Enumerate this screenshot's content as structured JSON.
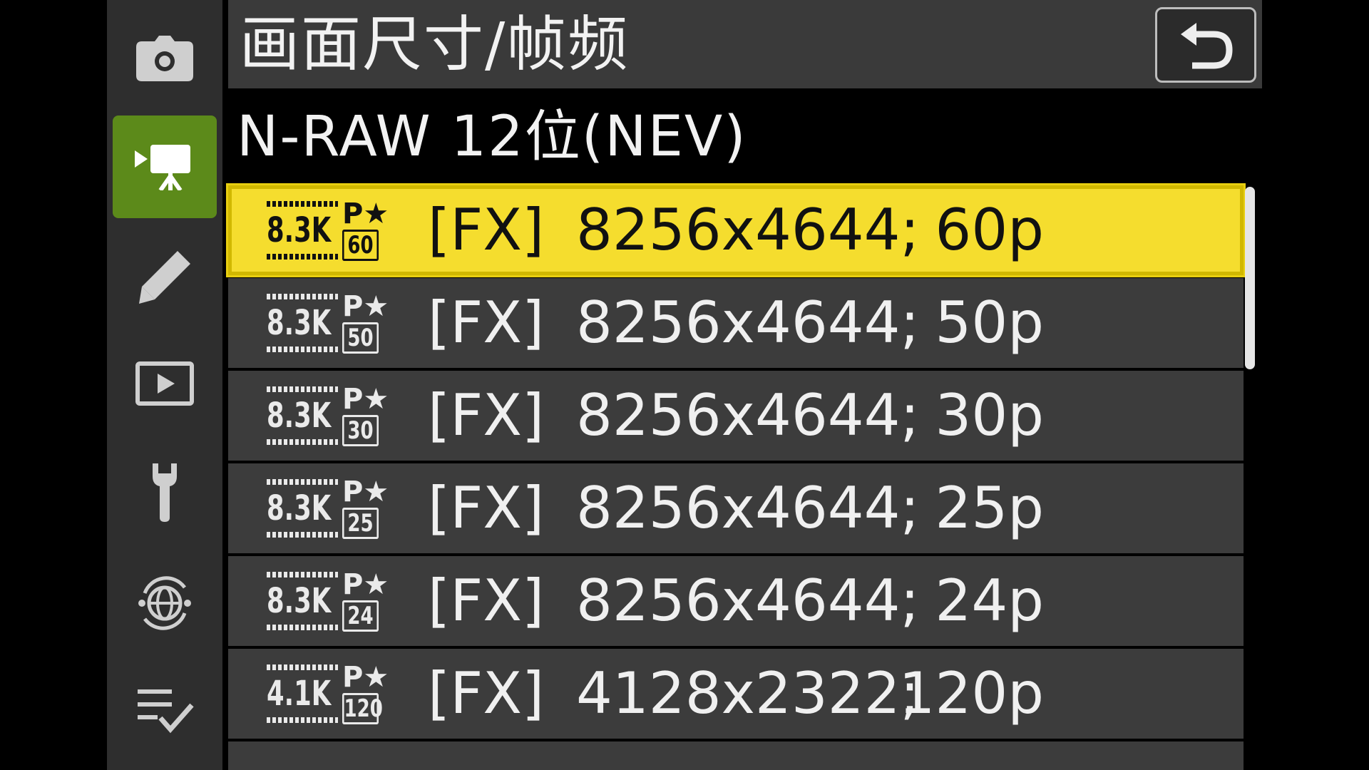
{
  "header": {
    "title": "画面尺寸/帧频",
    "back_icon": "return-arrow-icon"
  },
  "subtitle": "N-RAW 12位(NEV)",
  "sidebar": {
    "items": [
      {
        "name": "photo-shooting-menu",
        "icon": "camera-icon",
        "active": false
      },
      {
        "name": "video-recording-menu",
        "icon": "movie-camera-icon",
        "active": true
      },
      {
        "name": "custom-settings-menu",
        "icon": "pencil-icon",
        "active": false
      },
      {
        "name": "playback-menu",
        "icon": "playback-icon",
        "active": false
      },
      {
        "name": "setup-menu",
        "icon": "wrench-icon",
        "active": false
      },
      {
        "name": "network-menu",
        "icon": "network-globe-icon",
        "active": false
      },
      {
        "name": "my-menu",
        "icon": "checklist-icon",
        "active": false
      }
    ]
  },
  "options": [
    {
      "res_badge": "8.3K",
      "pstar": "P★",
      "fps_badge": "60",
      "format": "[FX]",
      "dimensions": "8256x4644;",
      "rate": "60p",
      "selected": true
    },
    {
      "res_badge": "8.3K",
      "pstar": "P★",
      "fps_badge": "50",
      "format": "[FX]",
      "dimensions": "8256x4644;",
      "rate": "50p",
      "selected": false
    },
    {
      "res_badge": "8.3K",
      "pstar": "P★",
      "fps_badge": "30",
      "format": "[FX]",
      "dimensions": "8256x4644;",
      "rate": "30p",
      "selected": false
    },
    {
      "res_badge": "8.3K",
      "pstar": "P★",
      "fps_badge": "25",
      "format": "[FX]",
      "dimensions": "8256x4644;",
      "rate": "25p",
      "selected": false
    },
    {
      "res_badge": "8.3K",
      "pstar": "P★",
      "fps_badge": "24",
      "format": "[FX]",
      "dimensions": "8256x4644;",
      "rate": "24p",
      "selected": false
    },
    {
      "res_badge": "4.1K",
      "pstar": "P★",
      "fps_badge": "120",
      "format": "[FX]",
      "dimensions": "4128x2322;",
      "rate": "120p",
      "selected": false
    }
  ],
  "colors": {
    "selection": "#f5dd2e",
    "active_tab": "#5c8a1a",
    "header_bg": "#3a3a3a",
    "row_bg": "#3c3c3c"
  }
}
